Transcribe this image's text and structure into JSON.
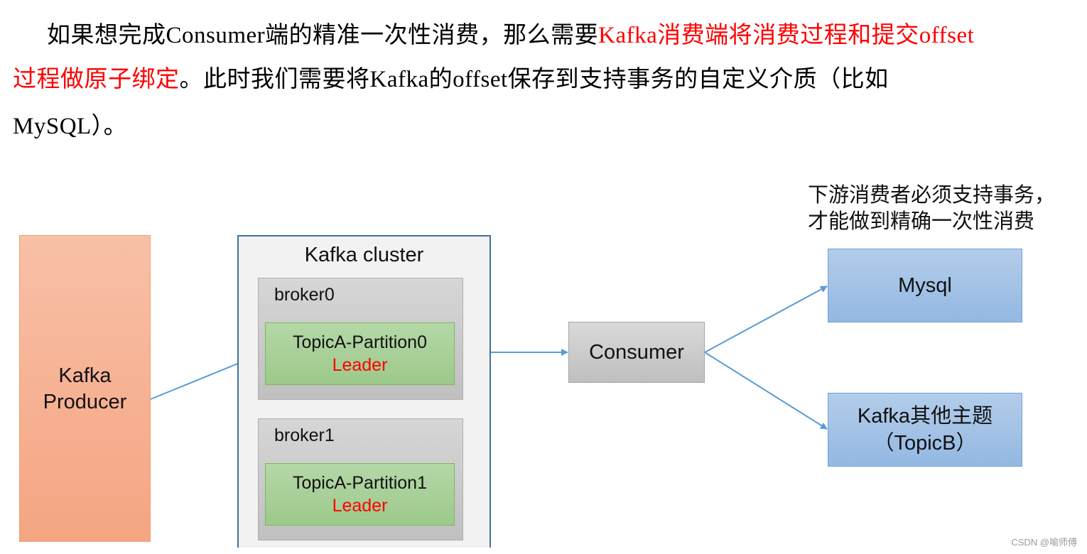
{
  "paragraph": {
    "line1": {
      "normal": "如果想完成Consumer端的精准一次性消费，那么需要",
      "highlight": "Kafka消费端将消费过程和提交offset"
    },
    "line2": {
      "highlight": "过程做原子绑定",
      "normal": "。此时我们需要将Kafka的offset保存到支持事务的自定义介质（比如"
    },
    "line3": "MySQL）。"
  },
  "diagram": {
    "producer": {
      "line1": "Kafka",
      "line2": "Producer"
    },
    "cluster": {
      "title": "Kafka cluster",
      "brokers": [
        {
          "name": "broker0",
          "partition": "TopicA-Partition0",
          "role": "Leader"
        },
        {
          "name": "broker1",
          "partition": "TopicA-Partition1",
          "role": "Leader"
        }
      ]
    },
    "consumer": "Consumer",
    "note": {
      "line1": "下游消费者必须支持事务，",
      "line2": "才能做到精确一次性消费"
    },
    "targets": [
      {
        "line1": "Mysql",
        "line2": ""
      },
      {
        "line1": "Kafka其他主题",
        "line2": "（TopicB）"
      }
    ],
    "arrow_color": "#5b9bd5"
  },
  "watermark": "CSDN @喻师傅"
}
